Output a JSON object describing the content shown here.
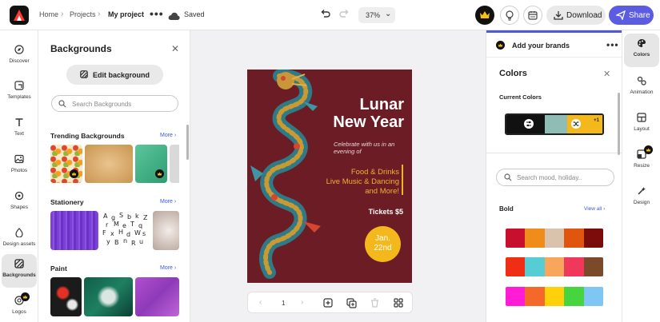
{
  "topbar": {
    "breadcrumb": [
      "Home",
      "Projects",
      "My project"
    ],
    "more": "•••",
    "saved": "Saved",
    "zoom": "37%",
    "download": "Download",
    "share": "Share"
  },
  "left_rail": {
    "items": [
      {
        "label": "Discover",
        "icon": "compass-icon"
      },
      {
        "label": "Templates",
        "icon": "templates-icon"
      },
      {
        "label": "Text",
        "icon": "text-icon"
      },
      {
        "label": "Photos",
        "icon": "photos-icon"
      },
      {
        "label": "Shapes",
        "icon": "shapes-icon"
      },
      {
        "label": "Design assets",
        "icon": "design-assets-icon"
      },
      {
        "label": "Backgrounds",
        "icon": "backgrounds-icon",
        "active": true
      },
      {
        "label": "Logos",
        "icon": "logos-icon",
        "premium": true
      }
    ]
  },
  "backgrounds_panel": {
    "title": "Backgrounds",
    "edit_button": "Edit background",
    "search_placeholder": "Search Backgrounds",
    "sections": [
      {
        "title": "Trending Backgrounds",
        "more": "More ›"
      },
      {
        "title": "Stationery",
        "more": "More ›"
      },
      {
        "title": "Paint",
        "more": "More ›"
      }
    ]
  },
  "poster": {
    "title_line1": "Lunar",
    "title_line2": "New Year",
    "subtitle": "Celebrate with us in an evening of",
    "event1": "Food & Drinks",
    "event2": "Live Music & Dancing",
    "event3": "and More!",
    "tickets": "Tickets $5",
    "date_line1": "Jan.",
    "date_line2": "22nd"
  },
  "pager": {
    "page": "1"
  },
  "colors_panel": {
    "brands": "Add your brands",
    "more": "•••",
    "title": "Colors",
    "current_label": "Current Colors",
    "current_colors": [
      "#111111",
      "#8fbcb4",
      "#f4b81d"
    ],
    "extra_count": "+1",
    "search_placeholder": "Search mood, holiday..",
    "bold_label": "Bold",
    "view_all": "View all ›",
    "palettes": [
      [
        "#c8102e",
        "#f08c1a",
        "#d9c3ad",
        "#e0560f",
        "#7a0c0c"
      ],
      [
        "#ef2e15",
        "#55cdd2",
        "#f7a65b",
        "#f0385a",
        "#7a4a2a"
      ],
      [
        "#ff1cd4",
        "#f5682c",
        "#ffd10a",
        "#46d43f",
        "#7fc6f5"
      ]
    ]
  },
  "right_rail": {
    "items": [
      {
        "label": "Colors",
        "icon": "colors-icon",
        "active": true
      },
      {
        "label": "Animation",
        "icon": "animation-icon"
      },
      {
        "label": "Layout",
        "icon": "layout-icon"
      },
      {
        "label": "Resize",
        "icon": "resize-icon",
        "premium": true
      },
      {
        "label": "Design",
        "icon": "design-icon"
      }
    ]
  }
}
